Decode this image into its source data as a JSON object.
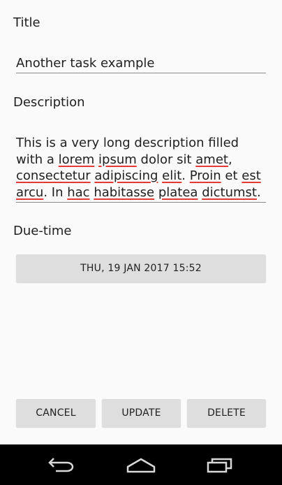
{
  "form": {
    "title_label": "Title",
    "title_value": "Another task example",
    "description_label": "Description",
    "description_parts": [
      {
        "text": "This is a very long description filled with a ",
        "spell": false
      },
      {
        "text": "lorem",
        "spell": true
      },
      {
        "text": " ",
        "spell": false
      },
      {
        "text": "ipsum",
        "spell": true
      },
      {
        "text": " dolor sit ",
        "spell": false
      },
      {
        "text": "amet",
        "spell": true
      },
      {
        "text": ", ",
        "spell": false
      },
      {
        "text": "consectetur",
        "spell": true
      },
      {
        "text": " ",
        "spell": false
      },
      {
        "text": "adipiscing",
        "spell": true
      },
      {
        "text": " ",
        "spell": false
      },
      {
        "text": "elit",
        "spell": true
      },
      {
        "text": ". ",
        "spell": false
      },
      {
        "text": "Proin",
        "spell": true
      },
      {
        "text": " et ",
        "spell": false
      },
      {
        "text": "est",
        "spell": true
      },
      {
        "text": " ",
        "spell": false
      },
      {
        "text": "arcu",
        "spell": true
      },
      {
        "text": ". In ",
        "spell": false
      },
      {
        "text": "hac",
        "spell": true
      },
      {
        "text": " ",
        "spell": false
      },
      {
        "text": "habitasse",
        "spell": true
      },
      {
        "text": " ",
        "spell": false
      },
      {
        "text": "platea",
        "spell": true
      },
      {
        "text": " ",
        "spell": false
      },
      {
        "text": "dictumst",
        "spell": true
      },
      {
        "text": ".",
        "spell": false
      }
    ],
    "due_label": "Due-time",
    "due_value": "THU, 19 JAN 2017 15:52"
  },
  "actions": {
    "cancel_label": "CANCEL",
    "update_label": "UPDATE",
    "delete_label": "DELETE"
  },
  "navbar": {
    "back_icon": "back-icon",
    "home_icon": "home-icon",
    "recents_icon": "recents-icon"
  },
  "colors": {
    "background": "#fafafa",
    "button": "#dedede",
    "spellcheck_underline": "#e53935",
    "navbar": "#000000"
  }
}
